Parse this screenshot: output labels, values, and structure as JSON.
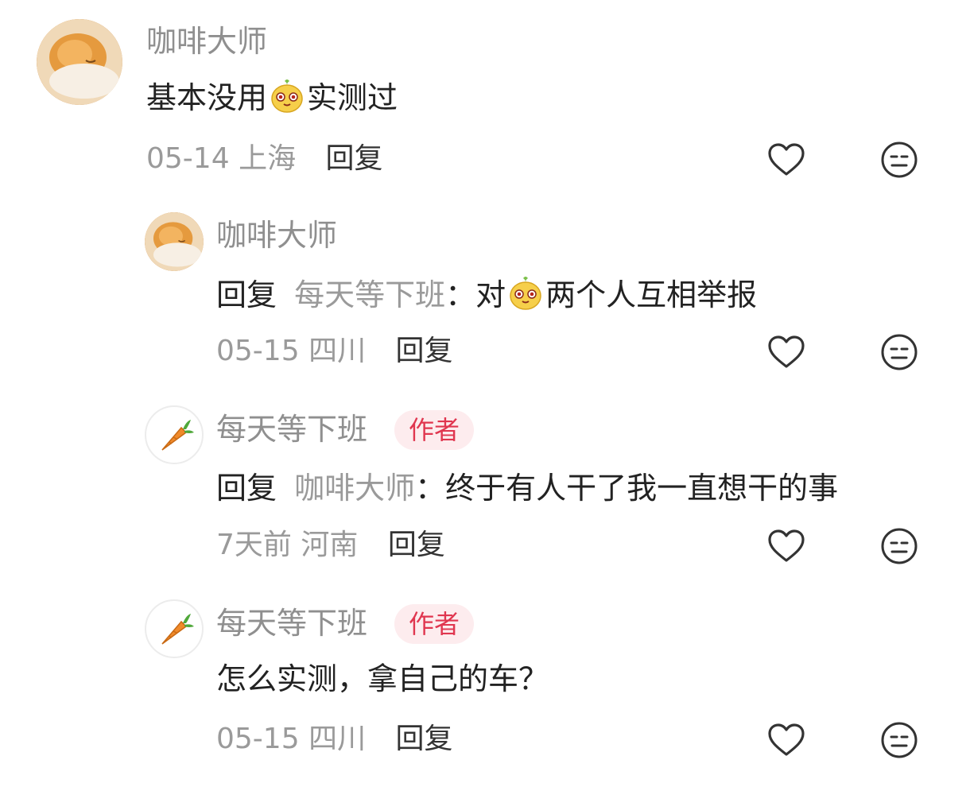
{
  "comments": [
    {
      "username": "咖啡大师",
      "text_before": "基本没用",
      "text_after": "实测过",
      "date": "05-14",
      "location": "上海",
      "reply_label": "回复"
    },
    {
      "username": "咖啡大师",
      "reply_prefix": "回复",
      "reply_target": "每天等下班",
      "text_before": "：对",
      "text_after": "两个人互相举报",
      "date": "05-15",
      "location": "四川",
      "reply_label": "回复"
    },
    {
      "username": "每天等下班",
      "badge": "作者",
      "reply_prefix": "回复",
      "reply_target": "咖啡大师",
      "text": "：终于有人干了我一直想干的事",
      "date": "7天前",
      "location": "河南",
      "reply_label": "回复"
    },
    {
      "username": "每天等下班",
      "badge": "作者",
      "text": "怎么实测，拿自己的车？",
      "date": "05-15",
      "location": "四川",
      "reply_label": "回复"
    }
  ],
  "icons": {
    "like": "heart-outline-icon",
    "dislike": "neutral-face-icon",
    "emoji": "mascot-emoji-icon"
  },
  "colors": {
    "author_badge_bg": "#fdecee",
    "author_badge_text": "#e0364f"
  }
}
